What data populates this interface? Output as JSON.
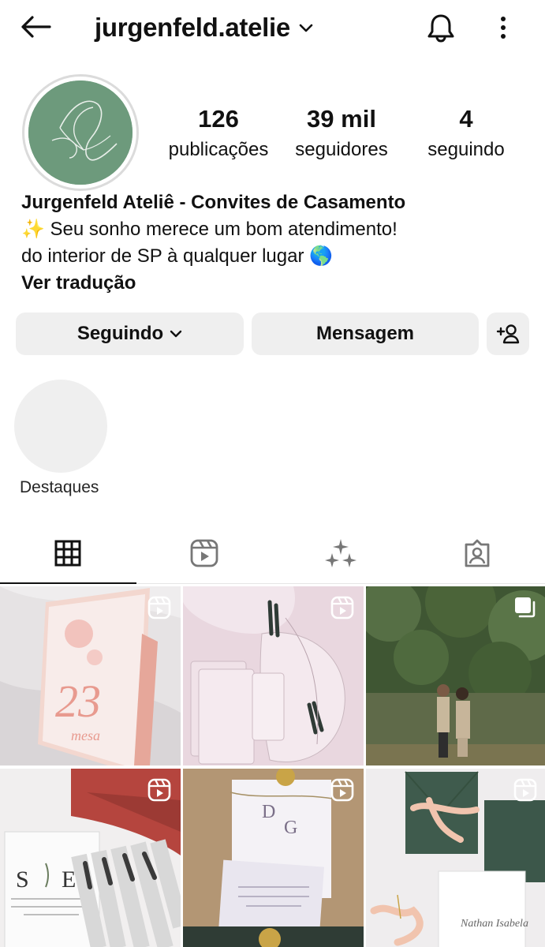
{
  "header": {
    "username": "jurgenfeld.atelie",
    "icons": {
      "back": "arrow-left-icon",
      "dropdown": "chevron-down-icon",
      "notifications": "bell-icon",
      "more": "more-vertical-icon"
    }
  },
  "profile": {
    "stats": [
      {
        "value": "126",
        "label": "publicações"
      },
      {
        "value": "39 mil",
        "label": "seguidores"
      },
      {
        "value": "4",
        "label": "seguindo"
      }
    ],
    "bio": {
      "name": "Jurgenfeld Ateliê - Convites de Casamento",
      "line1": "✨ Seu sonho merece um bom atendimento!",
      "line2": "do interior de SP à qualquer lugar 🌎",
      "translate": "Ver tradução"
    },
    "buttons": {
      "following": "Seguindo",
      "message": "Mensagem"
    }
  },
  "highlights": {
    "label": "Destaques"
  },
  "tabs": [
    {
      "icon": "grid-icon",
      "active": true
    },
    {
      "icon": "reels-icon",
      "active": false
    },
    {
      "icon": "sparkles-icon",
      "active": false
    },
    {
      "icon": "tagged-icon",
      "active": false
    }
  ],
  "posts": [
    {
      "kind": "reel",
      "badge": "reels-icon"
    },
    {
      "kind": "reel",
      "badge": "reels-icon"
    },
    {
      "kind": "carousel",
      "badge": "carousel-icon"
    },
    {
      "kind": "reel",
      "badge": "reels-icon"
    },
    {
      "kind": "reel",
      "badge": "reels-icon"
    },
    {
      "kind": "reel",
      "badge": "reels-icon"
    }
  ],
  "colors": {
    "avatar_bg": "#6d9a7c",
    "button_bg": "#efefef"
  }
}
